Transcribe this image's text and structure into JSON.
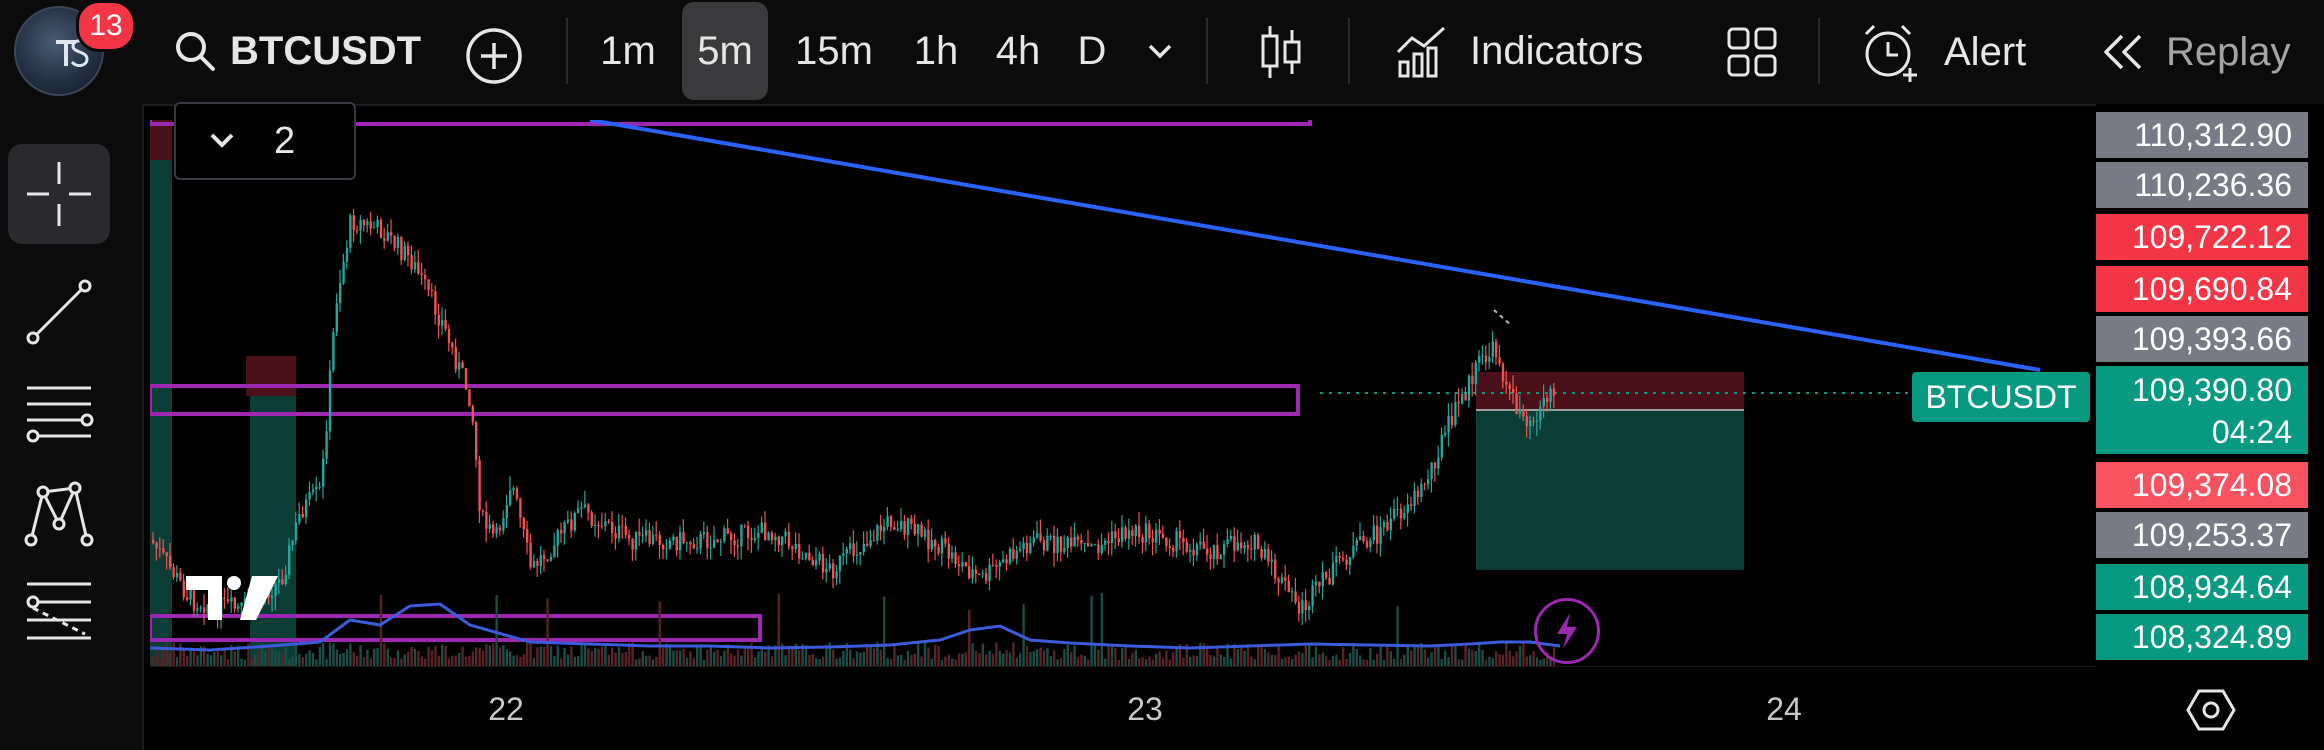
{
  "toolbar": {
    "notification_count": "13",
    "symbol": "BTCUSDT",
    "timeframes": [
      "1m",
      "5m",
      "15m",
      "1h",
      "4h",
      "D"
    ],
    "active_timeframe": "5m",
    "indicators_label": "Indicators",
    "alert_label": "Alert",
    "replay_label": "Replay"
  },
  "chart": {
    "layers_count": "2",
    "symbol_tag": "BTCUSDT",
    "x_labels": [
      "22",
      "23",
      "24"
    ],
    "price_labels": [
      {
        "value": "110,312.90",
        "color": "#787b86"
      },
      {
        "value": "110,236.36",
        "color": "#787b86"
      },
      {
        "value": "109,722.12",
        "color": "#f23645"
      },
      {
        "value": "109,690.84",
        "color": "#f23645"
      },
      {
        "value": "109,393.66",
        "color": "#787b86"
      },
      {
        "value": "109,390.80",
        "color": "#089981"
      },
      {
        "value": "04:24",
        "color": "#089981"
      },
      {
        "value": "109,374.08",
        "color": "#f7525f"
      },
      {
        "value": "109,253.37",
        "color": "#787b86"
      },
      {
        "value": "108,934.64",
        "color": "#089981"
      },
      {
        "value": "108,324.89",
        "color": "#089981"
      }
    ],
    "colors": {
      "up": "#26a69a",
      "down": "#ef5350",
      "trendline": "#2962ff",
      "zone": "#9c27b0",
      "volume_line": "#3b5bdb",
      "target": "#0b3d36",
      "stop": "#4a1218"
    }
  }
}
